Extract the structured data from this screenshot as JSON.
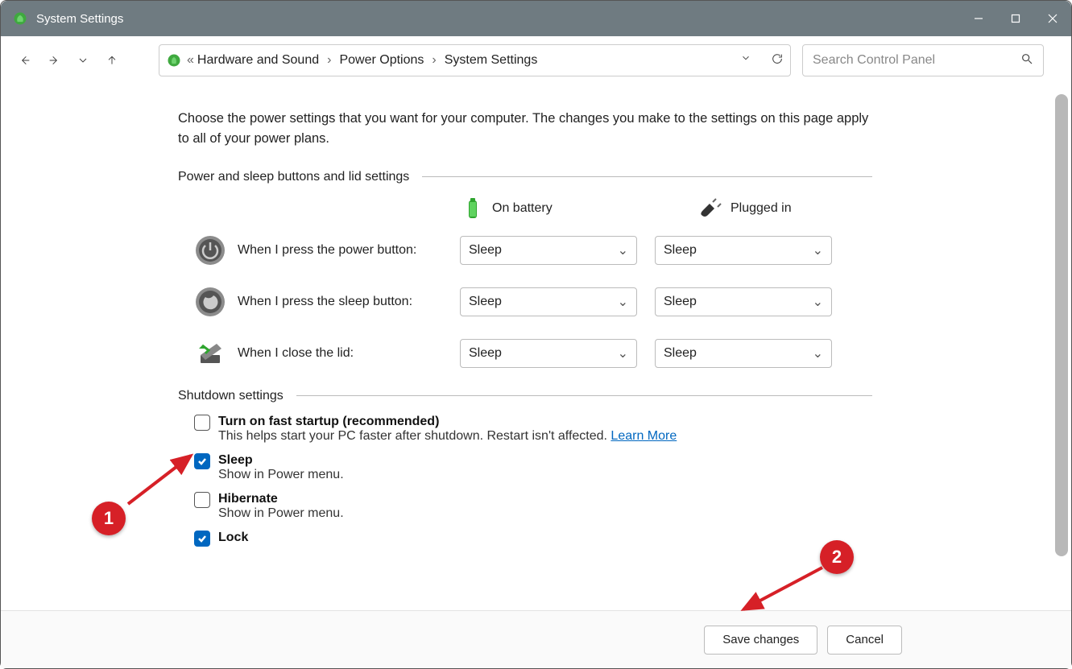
{
  "titlebar": {
    "title": "System Settings"
  },
  "breadcrumb": {
    "items": [
      "Hardware and Sound",
      "Power Options",
      "System Settings"
    ]
  },
  "search": {
    "placeholder": "Search Control Panel"
  },
  "intro": "Choose the power settings that you want for your computer. The changes you make to the settings on this page apply to all of your power plans.",
  "section1": {
    "title": "Power and sleep buttons and lid settings",
    "cols": {
      "battery": "On battery",
      "plugged": "Plugged in"
    },
    "rows": [
      {
        "label": "When I press the power button:",
        "battery": "Sleep",
        "plugged": "Sleep"
      },
      {
        "label": "When I press the sleep button:",
        "battery": "Sleep",
        "plugged": "Sleep"
      },
      {
        "label": "When I close the lid:",
        "battery": "Sleep",
        "plugged": "Sleep"
      }
    ]
  },
  "section2": {
    "title": "Shutdown settings",
    "items": [
      {
        "checked": false,
        "title": "Turn on fast startup (recommended)",
        "desc": "This helps start your PC faster after shutdown. Restart isn't affected. ",
        "link": "Learn More"
      },
      {
        "checked": true,
        "title": "Sleep",
        "desc": "Show in Power menu."
      },
      {
        "checked": false,
        "title": "Hibernate",
        "desc": "Show in Power menu."
      },
      {
        "checked": true,
        "title": "Lock",
        "desc": ""
      }
    ]
  },
  "footer": {
    "save": "Save changes",
    "cancel": "Cancel"
  },
  "annotations": {
    "m1": "1",
    "m2": "2"
  }
}
